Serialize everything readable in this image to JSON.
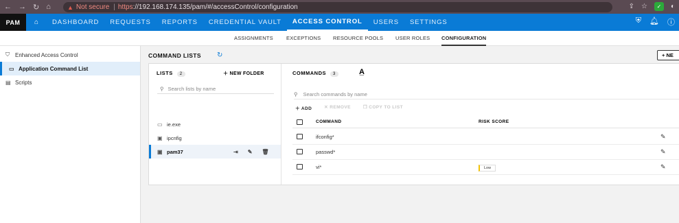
{
  "browser": {
    "nav": [
      "←",
      "→",
      "↻",
      "⌂"
    ],
    "warning_icon": "warning-triangle-icon",
    "not_secure": "Not secure",
    "url_scheme": "https",
    "url_rest": "://192.168.174.135/pam/#/accessControl/configuration"
  },
  "topnav": {
    "logo": "PAM",
    "items": [
      "DASHBOARD",
      "REQUESTS",
      "REPORTS",
      "CREDENTIAL VAULT",
      "ACCESS CONTROL",
      "USERS",
      "SETTINGS"
    ],
    "active": "ACCESS CONTROL"
  },
  "subnav": {
    "tabs": [
      "ASSIGNMENTS",
      "EXCEPTIONS",
      "RESOURCE POOLS",
      "USER ROLES",
      "CONFIGURATION"
    ],
    "active": "CONFIGURATION"
  },
  "sidebar": {
    "items": [
      {
        "label": "Enhanced Access Control",
        "icon": "shield-icon"
      },
      {
        "label": "Application Command List",
        "icon": "terminal-icon",
        "active": true
      },
      {
        "label": "Scripts",
        "icon": "script-icon"
      }
    ]
  },
  "main": {
    "title": "COMMAND LISTS",
    "new_button": "+ NE",
    "lists": {
      "header": "LISTS",
      "count": "2",
      "new_folder": "NEW FOLDER",
      "search_placeholder": "Search lists by name",
      "items": [
        {
          "name": "ie.exe"
        },
        {
          "name": "ipcnfig"
        },
        {
          "name": "pam37",
          "active": true
        }
      ]
    },
    "commands": {
      "header": "COMMANDS",
      "count": "3",
      "search_placeholder": "Search commands by name",
      "toolbar": {
        "add": "ADD",
        "remove": "REMOVE",
        "copy": "COPY TO LIST"
      },
      "columns": {
        "command": "COMMAND",
        "risk": "RISK SCORE"
      },
      "rows": [
        {
          "command": "ifconfig*",
          "risk": ""
        },
        {
          "command": "passwd*",
          "risk": ""
        },
        {
          "command": "vi*",
          "risk": "Low"
        }
      ]
    }
  },
  "colors": {
    "accent": "#0a7bd6",
    "browser": "#5a4a52",
    "risk_low": "#f2c100"
  }
}
